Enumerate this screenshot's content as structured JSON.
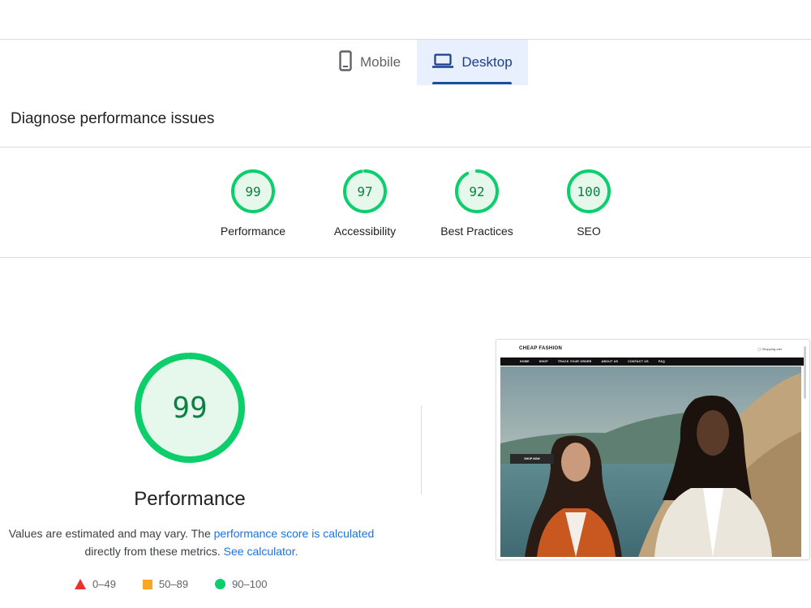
{
  "tabs": {
    "mobile_label": "Mobile",
    "desktop_label": "Desktop",
    "active": "desktop"
  },
  "section_heading": "Diagnose performance issues",
  "scores": [
    {
      "label": "Performance",
      "value": "99",
      "fraction": 0.99
    },
    {
      "label": "Accessibility",
      "value": "97",
      "fraction": 0.97
    },
    {
      "label": "Best Practices",
      "value": "92",
      "fraction": 0.92
    },
    {
      "label": "SEO",
      "value": "100",
      "fraction": 1.0
    }
  ],
  "performance": {
    "score": "99",
    "fraction": 0.99,
    "title": "Performance",
    "desc_prefix": "Values are estimated and may vary. The ",
    "desc_link": "performance score is calculated",
    "desc_middle": " directly from these metrics. ",
    "desc_link2": "See calculator.",
    "legend": {
      "fail": "0–49",
      "average": "50–89",
      "pass": "90–100"
    }
  },
  "screenshot": {
    "brand": "CHEAP FASHION",
    "cart": "Shopping cart",
    "nav": [
      "HOME",
      "SHOP",
      "TRACK YOUR ORDER",
      "ABOUT US",
      "CONTACT US",
      "FAQ"
    ],
    "button": "SHOP NOW"
  },
  "colors": {
    "pass": "#0cce6b",
    "pass_text": "#0b8043",
    "pass_bg": "#e6f7ec",
    "average": "#f9a825",
    "fail": "#e8322e",
    "link": "#1a73e8",
    "active_tab_bg": "#e8f0fe"
  },
  "icons": {
    "mobile": "phone-icon",
    "desktop": "laptop-icon"
  }
}
